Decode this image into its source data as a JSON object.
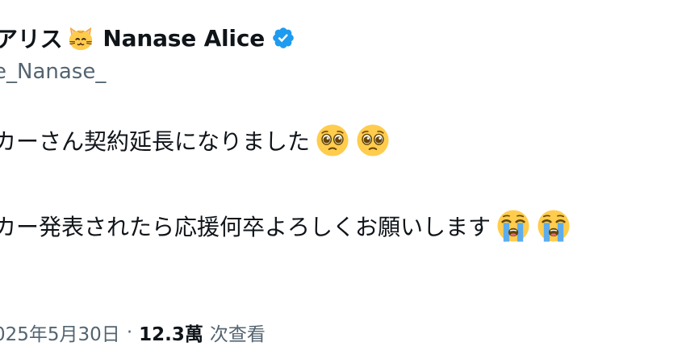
{
  "author": {
    "display_name_prefix": "アリス",
    "cat_emoji": "cat-face-icon",
    "display_name": "Nanase Alice",
    "verified_icon": "verified-badge-icon",
    "verified_color": "#1d9bf0",
    "handle": "e_Nanase_"
  },
  "tweet": {
    "line1_text": "カーさん契約延長になりました",
    "line1_emoji": [
      "pleading-face-icon",
      "pleading-face-icon"
    ],
    "line2_text": "カー発表されたら応援何卒よろしくお願いします",
    "line2_emoji": [
      "loudly-crying-face-icon",
      "loudly-crying-face-icon"
    ]
  },
  "meta": {
    "date": "025年5月30日",
    "separator": "·",
    "views_count": "12.3萬",
    "views_label": "次查看"
  },
  "colors": {
    "text_primary": "#0f1419",
    "text_secondary": "#536471",
    "accent": "#1d9bf0"
  }
}
